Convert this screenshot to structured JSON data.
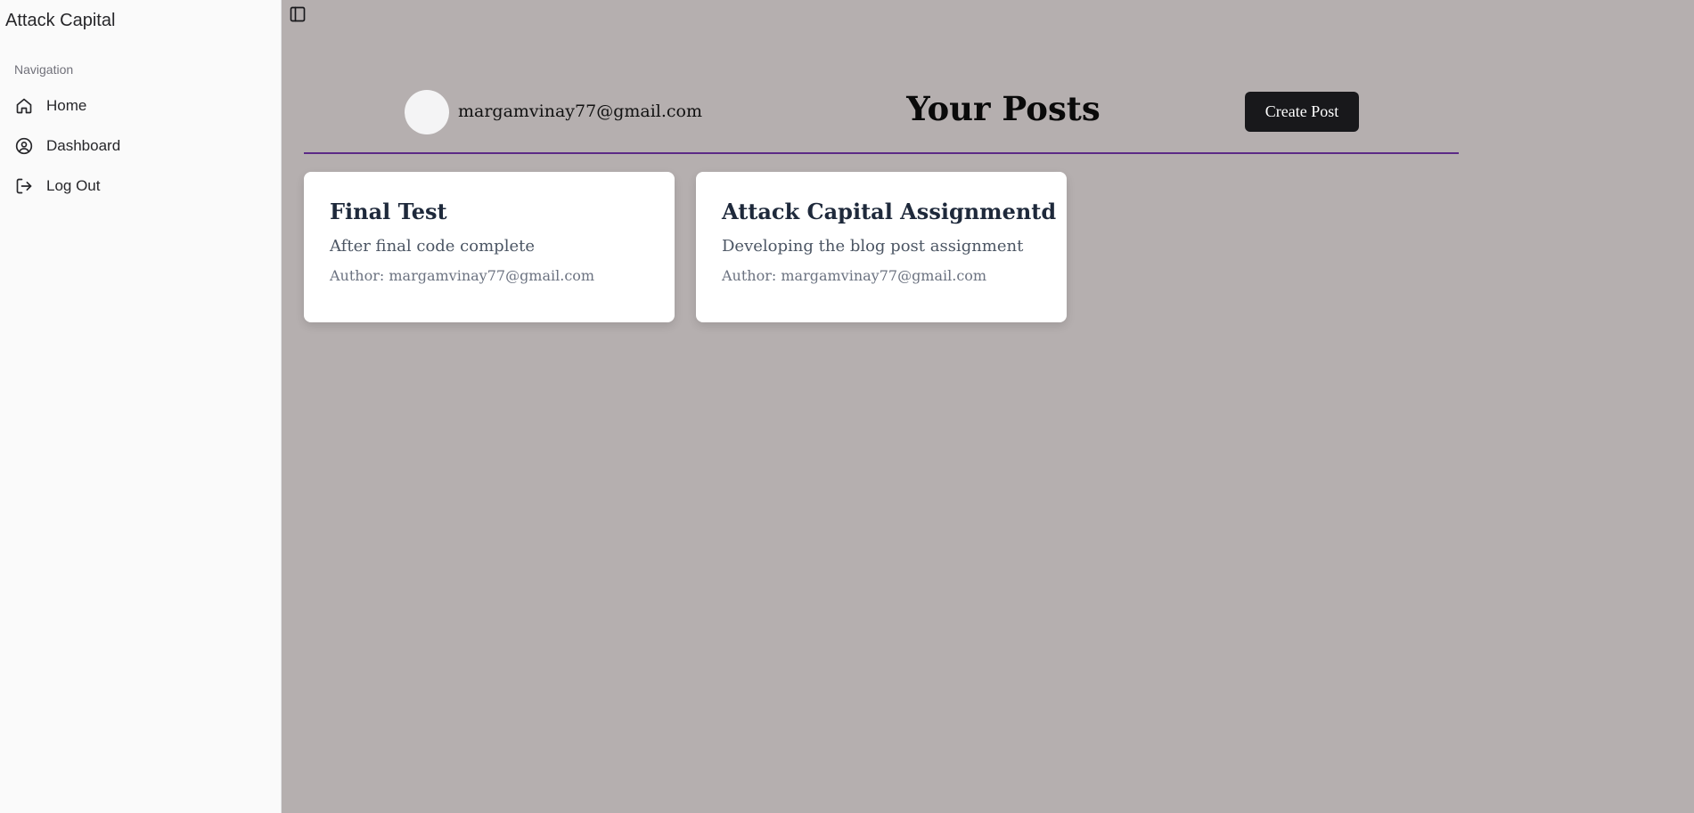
{
  "app": {
    "brand": "Attack Capital"
  },
  "sidebar": {
    "group_label": "Navigation",
    "items": [
      {
        "label": "Home",
        "icon": "home-icon"
      },
      {
        "label": "Dashboard",
        "icon": "user-circle-icon"
      },
      {
        "label": "Log Out",
        "icon": "log-out-icon"
      }
    ]
  },
  "header": {
    "user_email": "margamvinay77@gmail.com",
    "title": "Your Posts",
    "create_label": "Create Post"
  },
  "posts": [
    {
      "title": "Final Test",
      "description": "After final code complete",
      "author": "Author: margamvinay77@gmail.com"
    },
    {
      "title": "Attack Capital Assignmentd",
      "description": "Developing the blog post assignment",
      "author": "Author: margamvinay77@gmail.com"
    }
  ],
  "colors": {
    "sidebar_bg": "#fafafa",
    "main_bg": "#b5afaf",
    "divider": "#5b2a86",
    "button_bg": "#18181b"
  }
}
